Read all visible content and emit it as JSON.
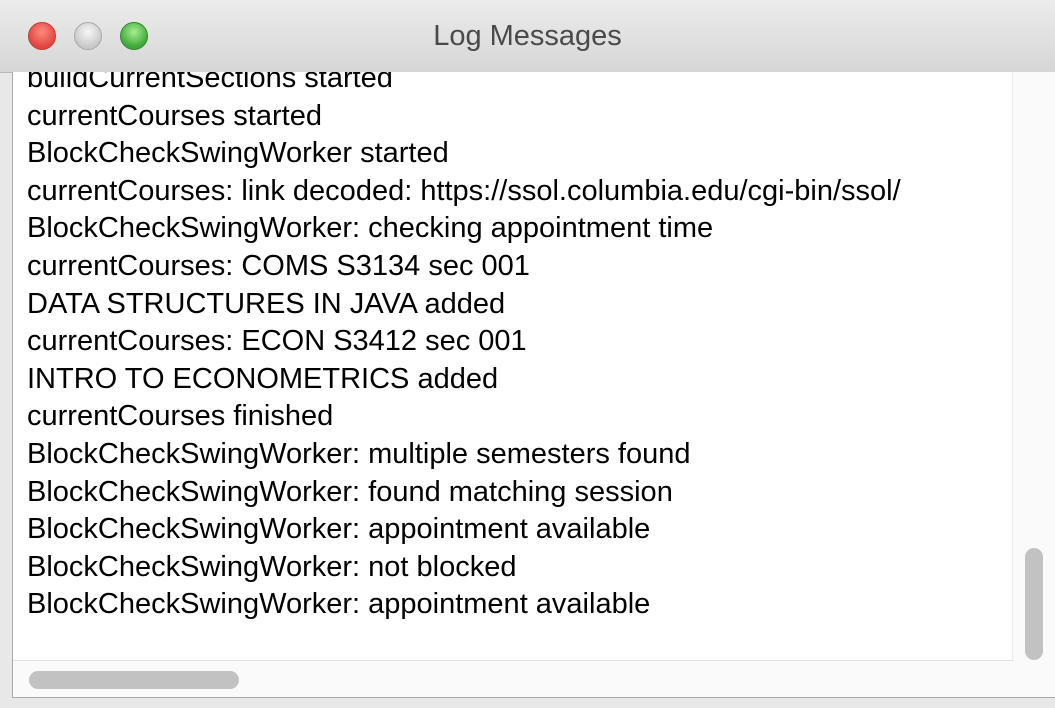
{
  "window": {
    "title": "Log Messages"
  },
  "log": {
    "lines": [
      "buildCurrentSections started",
      "currentCourses started",
      "BlockCheckSwingWorker started",
      "currentCourses: link decoded: https://ssol.columbia.edu/cgi-bin/ssol/",
      "BlockCheckSwingWorker: checking appointment time",
      "currentCourses: COMS S3134 sec 001",
      "DATA STRUCTURES IN JAVA added",
      "currentCourses: ECON S3412 sec 001",
      "INTRO TO ECONOMETRICS added",
      "currentCourses finished",
      "BlockCheckSwingWorker: multiple semesters found",
      "BlockCheckSwingWorker: found matching session",
      "BlockCheckSwingWorker: appointment available",
      "BlockCheckSwingWorker: not blocked",
      "BlockCheckSwingWorker: appointment available"
    ]
  },
  "scrollbars": {
    "vertical_position": 0.95,
    "horizontal_position": 0.0
  },
  "colors": {
    "close": "#e0443e",
    "minimize": "#c8c8c8",
    "zoom": "#3ea63a",
    "text": "#000000",
    "title": "#4a4a4a"
  }
}
